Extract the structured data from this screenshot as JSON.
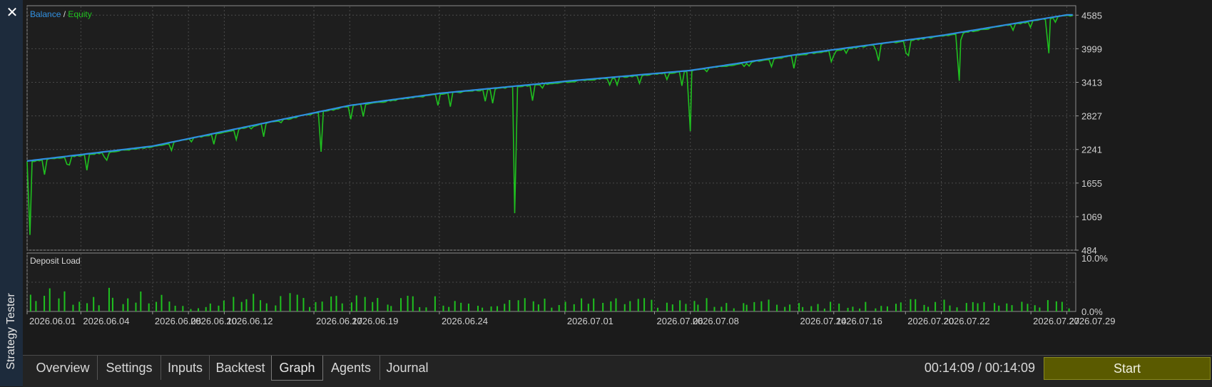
{
  "sidebar": {
    "close_icon": "close-icon",
    "label": "Strategy Tester"
  },
  "tabs": [
    {
      "label": "Overview",
      "active": false
    },
    {
      "label": "Settings",
      "active": false
    },
    {
      "label": "Inputs",
      "active": false
    },
    {
      "label": "Backtest",
      "active": false
    },
    {
      "label": "Graph",
      "active": true
    },
    {
      "label": "Agents",
      "active": false
    },
    {
      "label": "Journal",
      "active": false
    }
  ],
  "timer": "00:14:09 / 00:14:09",
  "start_label": "Start",
  "colors": {
    "balance": "#2f8fe0",
    "equity": "#1fc01f",
    "background": "#1b1b1b",
    "grid": "#4a4a4a",
    "start": "#5a5a00"
  },
  "chart_data": [
    {
      "type": "line",
      "title_balance": "Balance",
      "title_sep": " / ",
      "title_equity": "Equity",
      "yticks": [
        4585,
        3999,
        3413,
        2827,
        2241,
        1655,
        1069,
        484
      ],
      "ylim": [
        484,
        4750
      ],
      "x_start": "2026.06.01",
      "x_end": "2026.07.29",
      "grid": true,
      "series": [
        {
          "name": "Balance",
          "x": [
            "2026.06.01",
            "2026.06.08",
            "2026.06.17",
            "2026.06.19",
            "2026.06.24",
            "2026.07.01",
            "2026.07.08",
            "2026.07.14",
            "2026.07.22",
            "2026.07.29"
          ],
          "values": [
            2040,
            2300,
            2880,
            3010,
            3220,
            3430,
            3620,
            3900,
            4230,
            4590
          ]
        },
        {
          "name": "Equity",
          "x": [
            "2026.06.01",
            "2026.06.01",
            "2026.06.02",
            "2026.06.16",
            "2026.06.17",
            "2026.06.28",
            "2026.06.28",
            "2026.07.08",
            "2026.07.08",
            "2026.07.23",
            "2026.07.23",
            "2026.07.28",
            "2026.07.28",
            "2026.07.29"
          ],
          "values": [
            2040,
            750,
            2050,
            2710,
            2200,
            3240,
            1130,
            3610,
            2560,
            4190,
            3440,
            4530,
            3920,
            4590
          ]
        }
      ]
    },
    {
      "type": "bar",
      "title": "Deposit Load",
      "yticks": [
        "10.0%",
        "0.0%"
      ],
      "ylim": [
        0,
        10
      ],
      "categories": [
        "2026.06.01",
        "2026.06.04",
        "2026.06.08",
        "2026.06.10",
        "2026.06.12",
        "2026.06.17",
        "2026.06.19",
        "2026.06.24",
        "2026.07.01",
        "2026.07.06",
        "2026.07.08",
        "2026.07.14",
        "2026.07.16",
        "2026.07.20",
        "2026.07.22",
        "2026.07.27",
        "2026.07.29"
      ],
      "values": [
        3.8,
        3.6,
        3.0,
        0.9,
        3.0,
        2.8,
        2.4,
        2.6,
        2.1,
        2.0,
        2.0,
        1.9,
        1.8,
        1.9,
        1.8,
        1.8,
        1.6
      ]
    }
  ]
}
